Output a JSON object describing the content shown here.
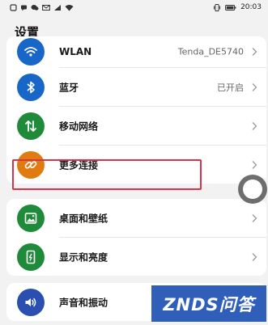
{
  "status_bar": {
    "time": "20:03",
    "icons": [
      "notification-icon",
      "message-icon",
      "wechat-icon",
      "mail-icon",
      "signal-icon",
      "wifi-icon",
      "vibrate-icon",
      "battery-icon"
    ]
  },
  "header": {
    "title": "设置"
  },
  "settings": {
    "wlan": {
      "label": "WLAN",
      "value": "Tenda_DE5740",
      "icon": "wifi-icon",
      "color": "#1766c8"
    },
    "bluetooth": {
      "label": "蓝牙",
      "value": "已开启",
      "icon": "bluetooth-icon",
      "color": "#1766c8"
    },
    "mobile_network": {
      "label": "移动网络",
      "icon": "mobile-data-icon",
      "color": "#1f8a3a"
    },
    "more_connections": {
      "label": "更多连接",
      "icon": "link-icon",
      "color": "#e07b10"
    },
    "desktop_wallpaper": {
      "label": "桌面和壁纸",
      "icon": "wallpaper-icon",
      "color": "#1f8a3a"
    },
    "display_brightness": {
      "label": "显示和亮度",
      "icon": "display-icon",
      "color": "#1f8a3a"
    },
    "sound_vibration": {
      "label": "声音和振动",
      "icon": "sound-icon",
      "color": "#2a4fb0"
    }
  },
  "highlight_color": "#d9324b",
  "watermark": {
    "text": "ZNDS问答"
  }
}
